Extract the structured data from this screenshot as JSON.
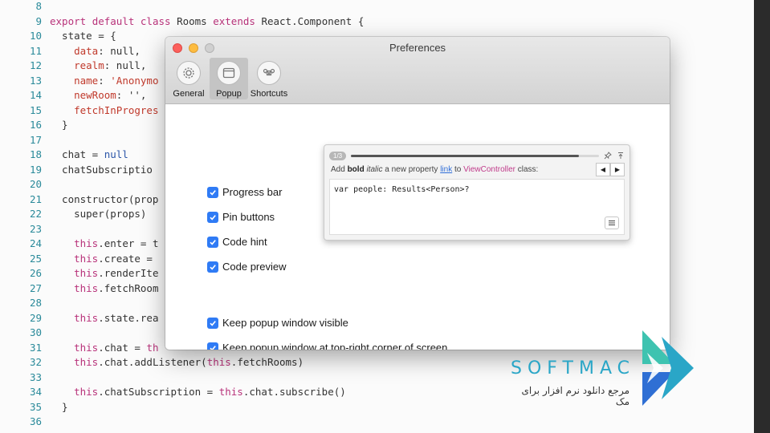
{
  "editor": {
    "lines": [
      {
        "n": "8",
        "segs": []
      },
      {
        "n": "9",
        "segs": [
          [
            "kw",
            "export "
          ],
          [
            "kw",
            "default "
          ],
          [
            "kw",
            "class "
          ],
          [
            "",
            "Rooms "
          ],
          [
            "kw",
            "extends "
          ],
          [
            "",
            "React.Component {"
          ]
        ]
      },
      {
        "n": "10",
        "segs": [
          [
            "",
            "  state = {"
          ]
        ]
      },
      {
        "n": "11",
        "segs": [
          [
            "",
            "    "
          ],
          [
            "str",
            "data"
          ],
          [
            "",
            ": null,"
          ]
        ]
      },
      {
        "n": "12",
        "segs": [
          [
            "",
            "    "
          ],
          [
            "str",
            "realm"
          ],
          [
            "",
            ": null,"
          ]
        ]
      },
      {
        "n": "13",
        "segs": [
          [
            "",
            "    "
          ],
          [
            "str",
            "name"
          ],
          [
            "",
            ": "
          ],
          [
            "str",
            "'Anonymo"
          ]
        ]
      },
      {
        "n": "14",
        "segs": [
          [
            "",
            "    "
          ],
          [
            "str",
            "newRoom"
          ],
          [
            "",
            ": '',"
          ]
        ]
      },
      {
        "n": "15",
        "segs": [
          [
            "",
            "    "
          ],
          [
            "str",
            "fetchInProgres"
          ]
        ]
      },
      {
        "n": "16",
        "segs": [
          [
            "",
            "  }"
          ]
        ]
      },
      {
        "n": "17",
        "segs": []
      },
      {
        "n": "18",
        "segs": [
          [
            "",
            "  chat = "
          ],
          [
            "cl",
            "null"
          ]
        ]
      },
      {
        "n": "19",
        "segs": [
          [
            "",
            "  chatSubscriptio"
          ]
        ]
      },
      {
        "n": "20",
        "segs": []
      },
      {
        "n": "21",
        "segs": [
          [
            "",
            "  constructor(prop"
          ]
        ]
      },
      {
        "n": "22",
        "segs": [
          [
            "",
            "    super(props)"
          ]
        ]
      },
      {
        "n": "23",
        "segs": []
      },
      {
        "n": "24",
        "segs": [
          [
            "",
            "    "
          ],
          [
            "kw",
            "this"
          ],
          [
            "",
            ".enter = t"
          ]
        ]
      },
      {
        "n": "25",
        "segs": [
          [
            "",
            "    "
          ],
          [
            "kw",
            "this"
          ],
          [
            "",
            ".create = "
          ]
        ]
      },
      {
        "n": "26",
        "segs": [
          [
            "",
            "    "
          ],
          [
            "kw",
            "this"
          ],
          [
            "",
            ".renderIte"
          ]
        ]
      },
      {
        "n": "27",
        "segs": [
          [
            "",
            "    "
          ],
          [
            "kw",
            "this"
          ],
          [
            "",
            ".fetchRoom"
          ]
        ]
      },
      {
        "n": "28",
        "segs": []
      },
      {
        "n": "29",
        "segs": [
          [
            "",
            "    "
          ],
          [
            "kw",
            "this"
          ],
          [
            "",
            ".state.rea"
          ]
        ]
      },
      {
        "n": "30",
        "segs": []
      },
      {
        "n": "31",
        "segs": [
          [
            "",
            "    "
          ],
          [
            "kw",
            "this"
          ],
          [
            "",
            ".chat = "
          ],
          [
            "kw",
            "th"
          ]
        ]
      },
      {
        "n": "32",
        "segs": [
          [
            "",
            "    "
          ],
          [
            "kw",
            "this"
          ],
          [
            "",
            ".chat.addListener("
          ],
          [
            "kw",
            "this"
          ],
          [
            "",
            ".fetchRooms)"
          ]
        ]
      },
      {
        "n": "33",
        "segs": []
      },
      {
        "n": "34",
        "segs": [
          [
            "",
            "    "
          ],
          [
            "kw",
            "this"
          ],
          [
            "",
            ".chatSubscription = "
          ],
          [
            "kw",
            "this"
          ],
          [
            "",
            ".chat.subscribe()"
          ]
        ]
      },
      {
        "n": "35",
        "segs": [
          [
            "",
            "  }"
          ]
        ]
      },
      {
        "n": "36",
        "segs": []
      }
    ]
  },
  "window": {
    "title": "Preferences",
    "tabs": [
      {
        "label": "General",
        "icon": "gear-icon"
      },
      {
        "label": "Popup",
        "icon": "window-icon",
        "active": true
      },
      {
        "label": "Shortcuts",
        "icon": "command-icon"
      }
    ]
  },
  "options": {
    "progress_bar": "Progress bar",
    "pin_buttons": "Pin buttons",
    "code_hint": "Code hint",
    "code_preview": "Code preview",
    "keep_visible": "Keep popup window visible",
    "keep_top_right": "Keep popup window at top-right corner of screen"
  },
  "popup_preview": {
    "counter": "1/3",
    "progress": 0.92,
    "head_prefix": "Add ",
    "head_bold": "bold",
    "head_space1": " ",
    "head_italic": "italic",
    "head_mid": " a new property ",
    "head_link": "link",
    "head_to": " to ",
    "head_class": "ViewController",
    "head_suffix": " class:",
    "prev": "◀",
    "next": "▶",
    "code": "var people: Results<Person>?"
  },
  "brand": {
    "name": "SOFTMAC",
    "tagline": "مرجع دانلود نرم افزار برای مک"
  },
  "colors": {
    "accent": "#2f7bf5",
    "brand": "#2aa6c7"
  }
}
